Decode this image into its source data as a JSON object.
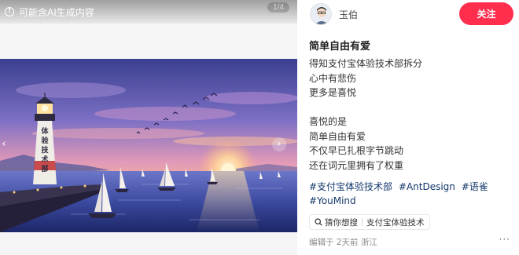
{
  "media": {
    "ai_notice": "可能含AI生成内容",
    "page_indicator": "1/4",
    "lighthouse_text": [
      "体",
      "验",
      "技",
      "术",
      "部"
    ],
    "prev_icon": "chevron-left-icon",
    "next_icon": "chevron-right-icon"
  },
  "author": {
    "name": "玉伯",
    "follow_label": "关注"
  },
  "note": {
    "title": "简单自由有爱",
    "lines": [
      "得知支付宝体验技术部拆分",
      "心中有悲伤",
      "更多是喜悦",
      "",
      "喜悦的是",
      "简单自由有爱",
      "不仅早已扎根字节跳动",
      "还在词元里拥有了权重"
    ],
    "tags": [
      "#支付宝体验技术部",
      "#AntDesign",
      "#语雀",
      "#YouMind"
    ]
  },
  "search_chip": {
    "label": "猜你想搜",
    "query": "支付宝体验技术"
  },
  "footer": {
    "edited": "编辑于 2天前 浙江",
    "more": "···"
  },
  "colors": {
    "follow": "#ff2e4d",
    "tag": "#13386c"
  }
}
